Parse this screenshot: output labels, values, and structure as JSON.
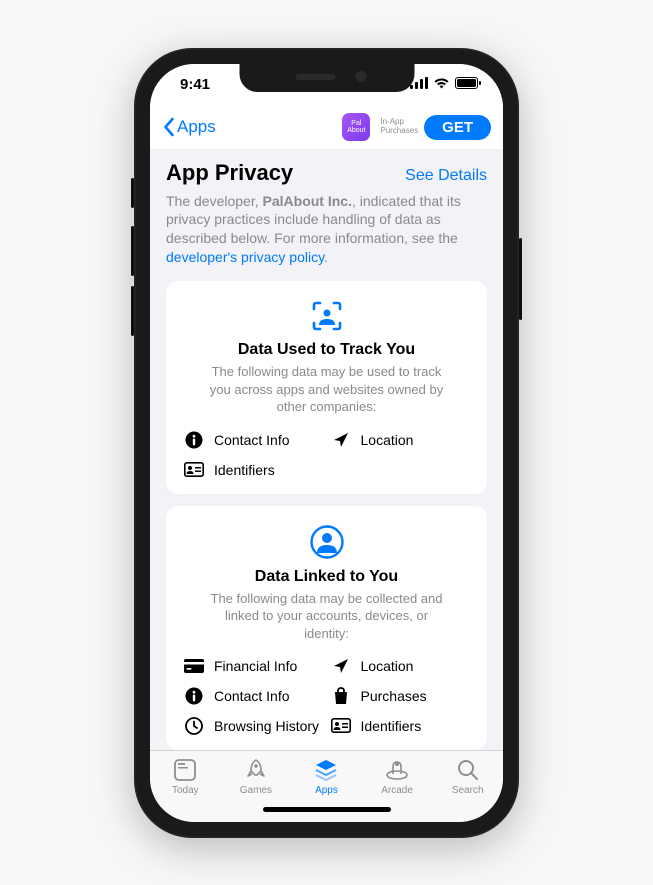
{
  "status": {
    "time": "9:41"
  },
  "nav": {
    "back_label": "Apps",
    "app_icon_text": "Pal\nAbout",
    "iap_line1": "In-App",
    "iap_line2": "Purchases",
    "get_label": "GET"
  },
  "header": {
    "title": "App Privacy",
    "see_details": "See Details"
  },
  "description": {
    "prefix": "The developer, ",
    "developer": "PalAbout Inc.",
    "suffix": ", indicated that its privacy practices include handling of data as described below. For more information, see the ",
    "link": "developer's privacy policy",
    "period": "."
  },
  "card1": {
    "title": "Data Used to Track You",
    "subtitle": "The following data may be used to track you across apps and websites owned by other companies:",
    "items": [
      "Contact Info",
      "Location",
      "Identifiers"
    ]
  },
  "card2": {
    "title": "Data Linked to You",
    "subtitle": "The following data may be collected and linked to your accounts, devices, or identity:",
    "items": [
      "Financial Info",
      "Location",
      "Contact Info",
      "Purchases",
      "Browsing History",
      "Identifiers"
    ]
  },
  "tabs": {
    "today": "Today",
    "games": "Games",
    "apps": "Apps",
    "arcade": "Arcade",
    "search": "Search"
  }
}
